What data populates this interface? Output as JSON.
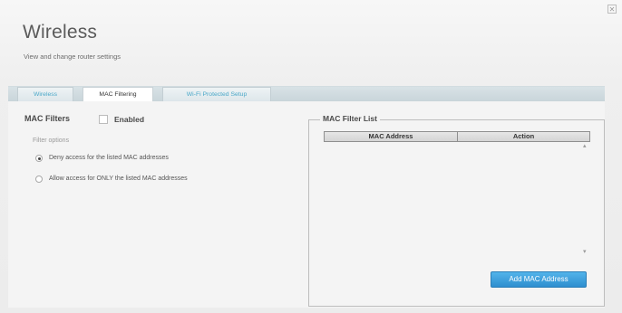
{
  "window": {
    "close_icon": "close-icon"
  },
  "header": {
    "title": "Wireless",
    "subtitle": "View and change router settings"
  },
  "tabs": [
    {
      "label": "Wireless",
      "active": false
    },
    {
      "label": "MAC Filtering",
      "active": true
    },
    {
      "label": "Wi-Fi Protected Setup",
      "active": false
    }
  ],
  "mac_filters": {
    "heading": "MAC Filters",
    "enabled_label": "Enabled",
    "enabled_checked": false,
    "filter_options_label": "Filter options",
    "options": [
      {
        "label": "Deny access for the listed MAC addresses",
        "selected": true
      },
      {
        "label": "Allow access for ONLY the listed MAC addresses",
        "selected": false
      }
    ]
  },
  "filter_list": {
    "legend": "MAC Filter List",
    "columns": [
      "MAC Address",
      "Action"
    ],
    "rows": [],
    "add_button_label": "Add MAC Address"
  },
  "colors": {
    "accent": "#3a9fdc",
    "tab_link": "#4ba8c8"
  }
}
